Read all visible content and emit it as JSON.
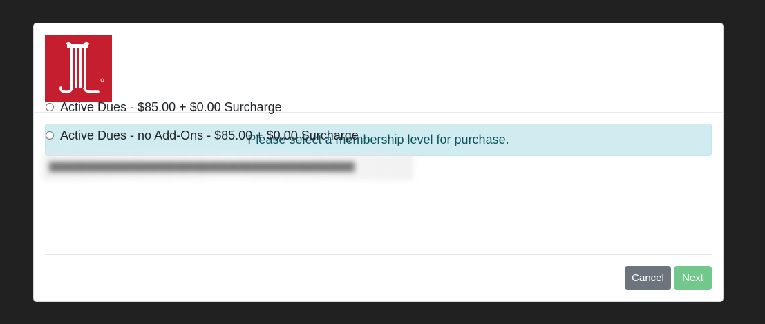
{
  "modal": {
    "logo": {
      "name": "JL",
      "color": "#c41e2f"
    },
    "alert": {
      "text": "Please select a membership level for purchase.",
      "bg": "#d1ecf1",
      "color": "#0c5460"
    },
    "options": [
      {
        "label": "Active Dues - $85.00 + $0.00 Surcharge",
        "checked": false
      },
      {
        "label": "Active Dues - no Add-Ons - $85.00 + $0.00 Surcharge",
        "checked": false
      }
    ],
    "footer": {
      "cancel_label": "Cancel",
      "next_label": "Next"
    }
  },
  "colors": {
    "backdrop": "#212121",
    "cancel": "#6c757d",
    "next": "#72c88a"
  }
}
